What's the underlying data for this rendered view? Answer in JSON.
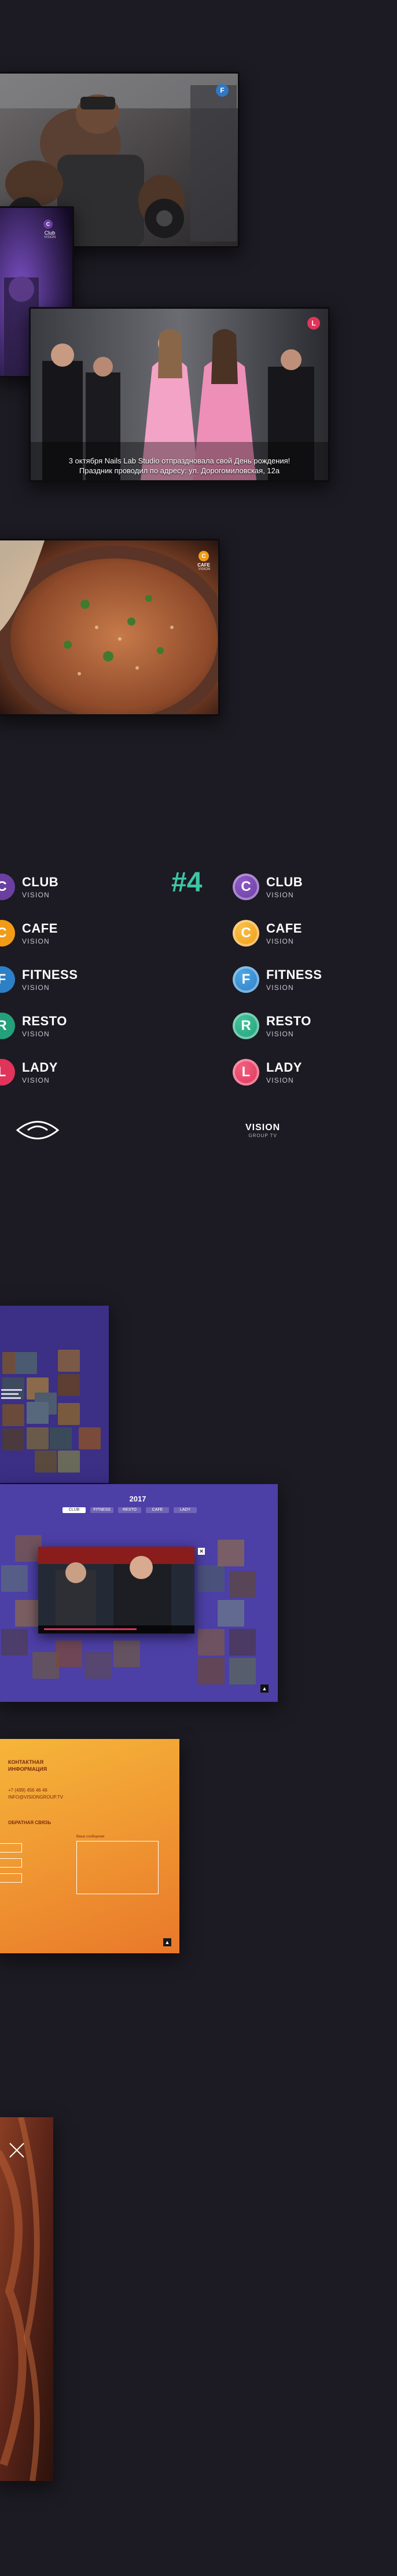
{
  "tv1": {
    "badge": "F",
    "colors": {
      "badge": "#2f78c4"
    }
  },
  "tv2": {
    "badge_title": "Club",
    "badge_sub": "VISION"
  },
  "tv3": {
    "caption": "3 октября Nails Lab Studio отпраздновала свой День рождения! Праздник проводил по адресу: ул. Дорогомиловская, 12а",
    "badge": "L"
  },
  "tv4": {
    "badge_title": "CAFE",
    "badge_sub": "VISION"
  },
  "brand": {
    "step_label": "#4",
    "sub_label": "VISION",
    "brands": [
      {
        "name": "CLUB",
        "letter": "C",
        "color": "#6a3fa0",
        "grad": "#8d5ac7"
      },
      {
        "name": "CAFE",
        "letter": "C",
        "color": "#f29b16",
        "grad": "#f7c04a"
      },
      {
        "name": "FITNESS",
        "letter": "F",
        "color": "#2d7fc6",
        "grad": "#4ea5e2"
      },
      {
        "name": "RESTO",
        "letter": "R",
        "color": "#24a07a",
        "grad": "#42c49a"
      },
      {
        "name": "LADY",
        "letter": "L",
        "color": "#e0345a",
        "grad": "#f0607e"
      }
    ],
    "group_label": "VISION",
    "group_sub": "GROUP TV"
  },
  "site1": {
    "accent": "#3b2f86"
  },
  "site2": {
    "title": "2017",
    "tabs": [
      "CLUB",
      "FITNESS",
      "RESTO",
      "CAFE",
      "LADY"
    ],
    "player_title": "",
    "colors": {
      "bg": "#4c3fa6"
    }
  },
  "site3": {
    "heading": "КОНТАКТНАЯ ИНФОРМАЦИЯ",
    "phone": "+7 (499) 456 46 46",
    "email": "INFO@VISIONGROUP.TV",
    "form_title": "ОБРАТНАЯ СВЯЗЬ",
    "field_label": "Ваше сообщение",
    "colors": {
      "top": "#f6b63a",
      "bottom": "#e9782a"
    }
  }
}
